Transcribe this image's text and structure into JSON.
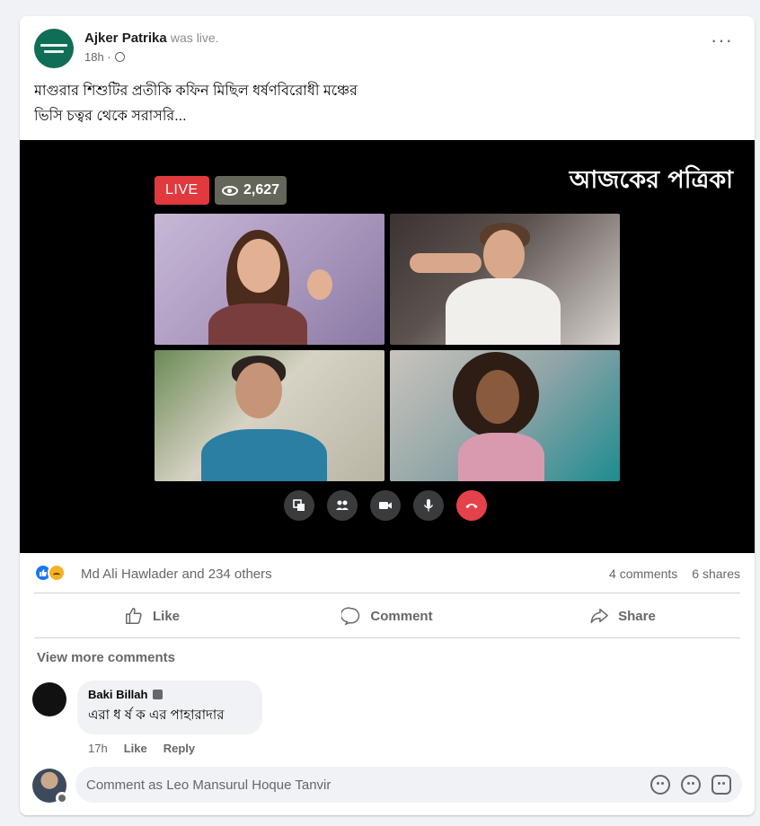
{
  "post": {
    "page_name": "Ajker Patrika",
    "status": "was live.",
    "time": "18h ·",
    "text_line1": "মাগুরার শিশুটির প্রতীকি কফিন মিছিল ধর্ষণবিরোধী মঞ্চের",
    "text_line2": "ভিসি চত্বর থেকে সরাসরি...",
    "more_icon": "more-horizontal-icon"
  },
  "video": {
    "brand": "আজকের পত্রিকা",
    "live_label": "LIVE",
    "viewers": "2,627",
    "controls": [
      "screen-share-icon",
      "people-icon",
      "camera-icon",
      "microphone-icon",
      "end-call-icon"
    ]
  },
  "stats": {
    "reactors": "Md Ali Hawlader and 234 others",
    "comments": "4 comments",
    "shares": "6 shares"
  },
  "actions": {
    "like": "Like",
    "comment": "Comment",
    "share": "Share"
  },
  "comments_section": {
    "view_more": "View more comments",
    "items": [
      {
        "author": "Baki Billah",
        "text": "এরা ধ র্ষ ক এর পাহারাদার",
        "time": "17h",
        "like": "Like",
        "reply": "Reply"
      }
    ]
  },
  "composer": {
    "placeholder": "Comment as Leo Mansurul Hoque Tanvir"
  },
  "colors": {
    "live_red": "#e0393e",
    "end_call_red": "#e4424a",
    "like_blue": "#1877f2",
    "page_green": "#0f6e55"
  }
}
